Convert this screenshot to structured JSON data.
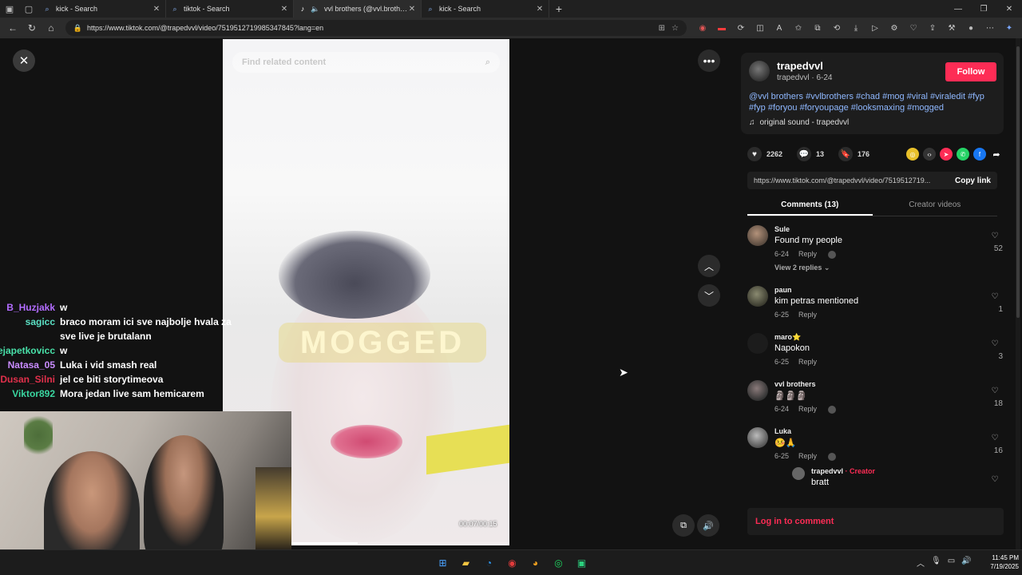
{
  "browser": {
    "tabs": [
      {
        "label": "kick - Search",
        "icon": "search-icon",
        "active": false
      },
      {
        "label": "tiktok - Search",
        "icon": "search-icon",
        "active": false
      },
      {
        "label": "vvl brothers (@vvl.brothers) |",
        "icon": "tiktok-icon",
        "active": true
      },
      {
        "label": "kick - Search",
        "icon": "search-icon",
        "active": false
      }
    ],
    "url": "https://www.tiktok.com/@trapedvvl/video/7519512719985347845?lang=en"
  },
  "video": {
    "search_placeholder": "Find related content",
    "overlay_text": "MOGGED",
    "time": "00:07/00:15",
    "progress": 0.47
  },
  "stream_chat": [
    {
      "user": "B_Huzjakk",
      "color": "#b26cff",
      "msg": "w"
    },
    {
      "user": "sagicc",
      "color": "#5be0c4",
      "msg": "braco moram ici sve najbolje hvala za sve live je brutalann"
    },
    {
      "user": "tejapetkovicc",
      "color": "#48e0a8",
      "msg": "w"
    },
    {
      "user": "Natasa_05",
      "color": "#c98cff",
      "msg": "Luka i vid smash real"
    },
    {
      "user": "Dusan_Silni",
      "color": "#e0304b",
      "msg": "jel ce biti storytimeova"
    },
    {
      "user": "Viktor892",
      "color": "#3ad6a0",
      "msg": "Mora jedan live sam hemicarem"
    }
  ],
  "post": {
    "author": "trapedvvl",
    "author_sub": "trapedvvl · 6-24",
    "follow_label": "Follow",
    "description": "@vvl brothers #vvlbrothers #chad #mog #viral #viraledit #fyp #fyp #foryou #foryoupage #looksmaxing #mogged",
    "sound": "original sound - trapedvvl",
    "likes": "2262",
    "comments": "13",
    "saves": "176",
    "link": "https://www.tiktok.com/@trapedvvl/video/7519512719...",
    "copy_label": "Copy link"
  },
  "panel_tabs": [
    {
      "label": "Comments (13)",
      "active": true
    },
    {
      "label": "Creator videos",
      "active": false
    }
  ],
  "comments": [
    {
      "name": "Sule",
      "text": "Found my people",
      "date": "6-24",
      "reply": "Reply",
      "likes": "52",
      "creator_liked": true,
      "view_replies": "View 2 replies"
    },
    {
      "name": "paun",
      "text": "kim petras mentioned",
      "date": "6-25",
      "reply": "Reply",
      "likes": "1",
      "creator_liked": false
    },
    {
      "name": "maro⭐",
      "text": "Napokon",
      "date": "6-25",
      "reply": "Reply",
      "likes": "3",
      "creator_liked": false
    },
    {
      "name": "vvl brothers",
      "text": "🗿🗿🗿",
      "date": "6-24",
      "reply": "Reply",
      "likes": "18",
      "creator_liked": true
    },
    {
      "name": "Luka",
      "text": "🤒🙏",
      "date": "6-25",
      "reply": "Reply",
      "likes": "16",
      "creator_liked": true
    }
  ],
  "sub_comment": {
    "name": "trapedvvl",
    "badge": "· Creator",
    "text": "bratt"
  },
  "login_label": "Log in to comment",
  "taskbar": {
    "time": "11:45 PM",
    "date": "7/19/2025"
  }
}
